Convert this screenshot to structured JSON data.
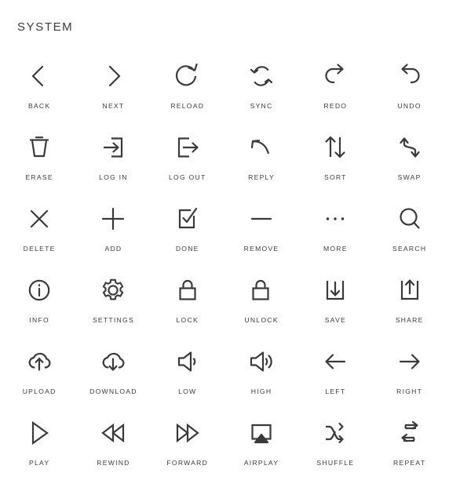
{
  "page": {
    "title": "SYSTEM",
    "stroke_color": "#3a3a3a",
    "background_color": "#ffffff",
    "label_color": "#3c3c3c",
    "columns": 6,
    "rows": 6
  },
  "icons": [
    {
      "label": "BACK",
      "name": "back-icon"
    },
    {
      "label": "NEXT",
      "name": "next-icon"
    },
    {
      "label": "RELOAD",
      "name": "reload-icon"
    },
    {
      "label": "SYNC",
      "name": "sync-icon"
    },
    {
      "label": "REDO",
      "name": "redo-icon"
    },
    {
      "label": "UNDO",
      "name": "undo-icon"
    },
    {
      "label": "ERASE",
      "name": "erase-icon"
    },
    {
      "label": "LOG IN",
      "name": "log-in-icon"
    },
    {
      "label": "LOG OUT",
      "name": "log-out-icon"
    },
    {
      "label": "REPLY",
      "name": "reply-icon"
    },
    {
      "label": "SORT",
      "name": "sort-icon"
    },
    {
      "label": "SWAP",
      "name": "swap-icon"
    },
    {
      "label": "DELETE",
      "name": "delete-icon"
    },
    {
      "label": "ADD",
      "name": "add-icon"
    },
    {
      "label": "DONE",
      "name": "done-icon"
    },
    {
      "label": "REMOVE",
      "name": "remove-icon"
    },
    {
      "label": "MORE",
      "name": "more-icon"
    },
    {
      "label": "SEARCH",
      "name": "search-icon"
    },
    {
      "label": "INFO",
      "name": "info-icon"
    },
    {
      "label": "SETTINGS",
      "name": "settings-icon"
    },
    {
      "label": "LOCK",
      "name": "lock-icon"
    },
    {
      "label": "UNLOCK",
      "name": "unlock-icon"
    },
    {
      "label": "SAVE",
      "name": "save-icon"
    },
    {
      "label": "SHARE",
      "name": "share-icon"
    },
    {
      "label": "UPLOAD",
      "name": "upload-icon"
    },
    {
      "label": "DOWNLOAD",
      "name": "download-icon"
    },
    {
      "label": "LOW",
      "name": "volume-low-icon"
    },
    {
      "label": "HIGH",
      "name": "volume-high-icon"
    },
    {
      "label": "LEFT",
      "name": "left-icon"
    },
    {
      "label": "RIGHT",
      "name": "right-icon"
    },
    {
      "label": "PLAY",
      "name": "play-icon"
    },
    {
      "label": "REWIND",
      "name": "rewind-icon"
    },
    {
      "label": "FORWARD",
      "name": "forward-icon"
    },
    {
      "label": "AIRPLAY",
      "name": "airplay-icon"
    },
    {
      "label": "SHUFFLE",
      "name": "shuffle-icon"
    },
    {
      "label": "REPEAT",
      "name": "repeat-icon"
    }
  ]
}
